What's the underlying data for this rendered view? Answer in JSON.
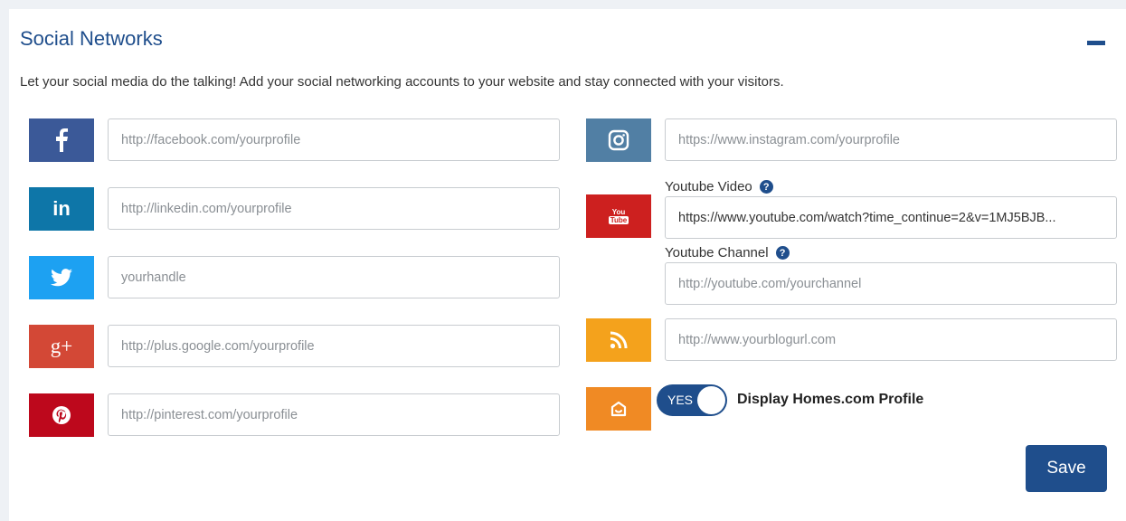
{
  "section": {
    "title": "Social Networks",
    "description": "Let your social media do the talking! Add your social networking accounts to your website and stay connected with your visitors."
  },
  "left_fields": [
    {
      "network": "facebook",
      "icon": "facebook-icon",
      "color": "#3b5998",
      "placeholder": "http://facebook.com/yourprofile"
    },
    {
      "network": "linkedin",
      "icon": "linkedin-icon",
      "color": "#0e76a8",
      "placeholder": "http://linkedin.com/yourprofile"
    },
    {
      "network": "twitter",
      "icon": "twitter-icon",
      "color": "#1da1f2",
      "placeholder": "yourhandle"
    },
    {
      "network": "google-plus",
      "icon": "google-plus-icon",
      "color": "#d34836",
      "glyph": "g+",
      "placeholder": "http://plus.google.com/yourprofile"
    },
    {
      "network": "pinterest",
      "icon": "pinterest-icon",
      "color": "#bd081c",
      "placeholder": "http://pinterest.com/yourprofile"
    }
  ],
  "right_fields": {
    "instagram": {
      "icon": "instagram-icon",
      "color": "#517fa4",
      "placeholder": "https://www.instagram.com/yourprofile"
    },
    "youtube": {
      "icon": "youtube-icon",
      "color": "#cd201f",
      "glyph_top": "You",
      "glyph_bottom": "Tube",
      "video_label": "Youtube Video",
      "video_value": "https://www.youtube.com/watch?time_continue=2&v=1MJ5BJB...",
      "channel_label": "Youtube Channel",
      "channel_placeholder": "http://youtube.com/yourchannel",
      "help_glyph": "?"
    },
    "blog": {
      "icon": "rss-icon",
      "color": "#f4a21c",
      "placeholder": "http://www.yourblogurl.com"
    },
    "homes": {
      "icon": "homes-icon",
      "color": "#f08a24",
      "toggle_text": "YES",
      "toggle_state": "on",
      "label": "Display Homes.com Profile"
    }
  },
  "actions": {
    "save_label": "Save"
  },
  "colors": {
    "accent": "#1f4e8c"
  }
}
